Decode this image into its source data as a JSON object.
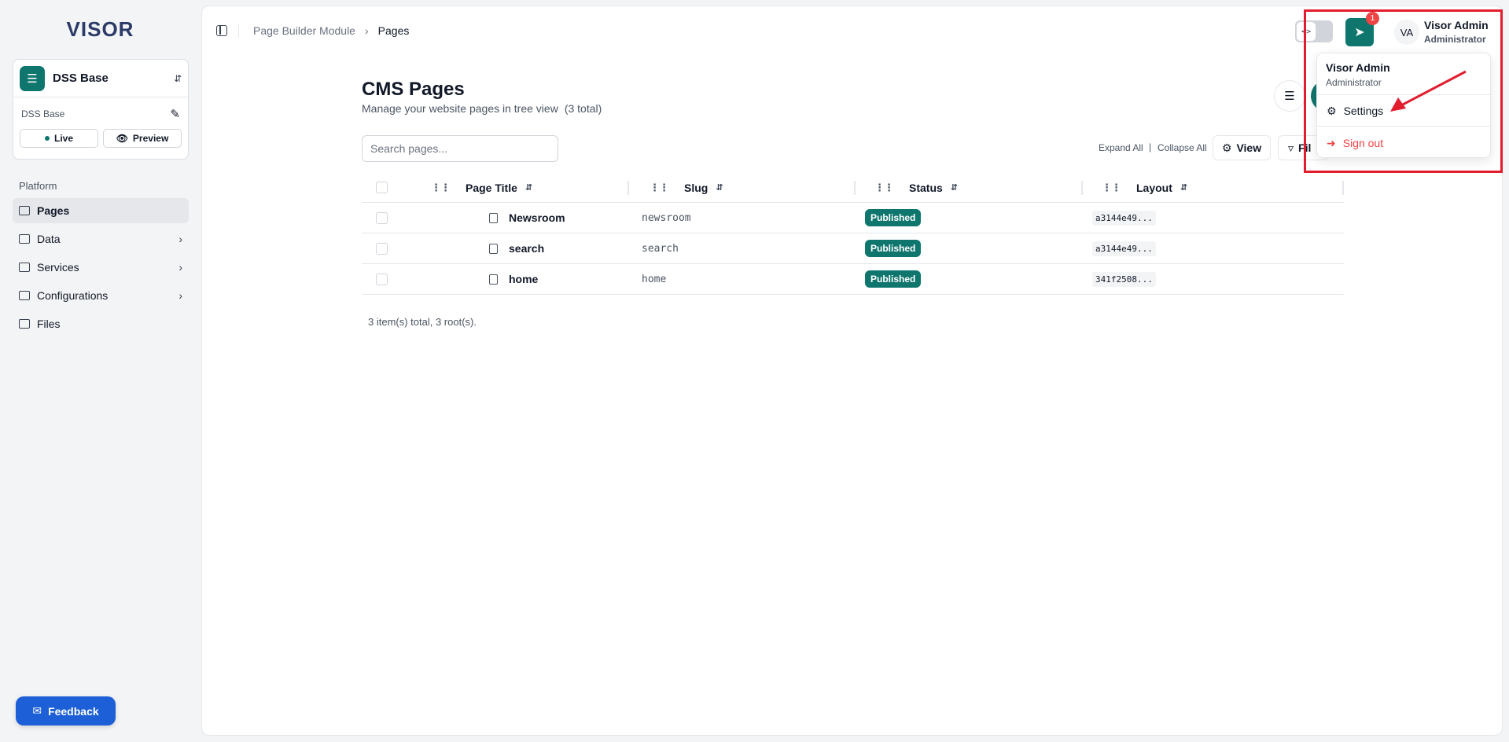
{
  "sidebar": {
    "logo": "VISOR",
    "workspace": {
      "name": "DSS Base",
      "sub_name": "DSS Base",
      "live_label": "Live",
      "preview_label": "Preview"
    },
    "section_label": "Platform",
    "items": [
      {
        "label": "Pages",
        "active": true,
        "has_children": false
      },
      {
        "label": "Data",
        "active": false,
        "has_children": true
      },
      {
        "label": "Services",
        "active": false,
        "has_children": true
      },
      {
        "label": "Configurations",
        "active": false,
        "has_children": true
      },
      {
        "label": "Files",
        "active": false,
        "has_children": false
      }
    ],
    "feedback_label": "Feedback"
  },
  "header": {
    "breadcrumb": [
      "Page Builder Module",
      "Pages"
    ],
    "notification_count": "1",
    "user": {
      "initials": "VA",
      "name": "Visor Admin",
      "role": "Administrator"
    }
  },
  "main": {
    "title": "CMS Pages",
    "subtitle": "Manage your website pages in tree view",
    "count_text": "(3 total)",
    "search_placeholder": "Search pages...",
    "expand_all": "Expand All",
    "separator": "|",
    "collapse_all": "Collapse All",
    "view_label": "View",
    "filter_label": "Fil",
    "columns": [
      "Page Title",
      "Slug",
      "Status",
      "Layout"
    ],
    "rows": [
      {
        "title": "Newsroom",
        "slug": "newsroom",
        "status": "Published",
        "layout": "a3144e49..."
      },
      {
        "title": "search",
        "slug": "search",
        "status": "Published",
        "layout": "a3144e49..."
      },
      {
        "title": "home",
        "slug": "home",
        "status": "Published",
        "layout": "341f2508..."
      }
    ],
    "footer": "3 item(s) total, 3 root(s)."
  },
  "user_menu": {
    "name": "Visor Admin",
    "role": "Administrator",
    "settings_label": "Settings",
    "signout_label": "Sign out"
  },
  "colors": {
    "accent": "#0f766e",
    "feedback": "#1d5fd6",
    "danger": "#ef4444",
    "highlight": "#e11d2e"
  }
}
